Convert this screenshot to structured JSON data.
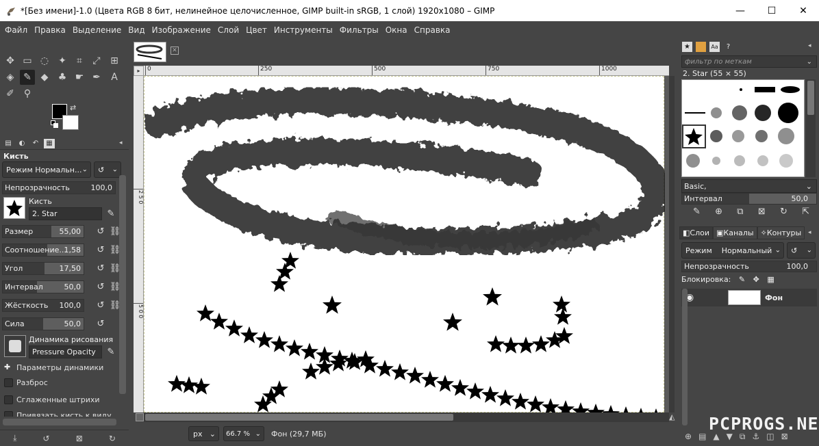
{
  "window": {
    "title": "*[Без имени]-1.0 (Цвета RGB 8 бит, нелинейное целочисленное, GIMP built-in sRGB, 1 слой) 1920x1080 – GIMP",
    "minimize": "—",
    "maximize": "☐",
    "close": "✕"
  },
  "menu": [
    "Файл",
    "Правка",
    "Выделение",
    "Вид",
    "Изображение",
    "Слой",
    "Цвет",
    "Инструменты",
    "Фильтры",
    "Окна",
    "Справка"
  ],
  "tool_options": {
    "title": "Кисть",
    "mode": "Режим Нормальн...",
    "opacity_label": "Непрозрачность",
    "opacity_value": "100,0",
    "brush_label": "Кисть",
    "brush_value": "2. Star",
    "size_label": "Размер",
    "size_value": "55,00",
    "aspect_label": "Соотношение...",
    "aspect_value": "1,58",
    "angle_label": "Угол",
    "angle_value": "17,50",
    "spacing_label": "Интервал",
    "spacing_value": "50,0",
    "hardness_label": "Жёсткость",
    "hardness_value": "100,0",
    "force_label": "Сила",
    "force_value": "50,0",
    "dynamics_label": "Динамика рисования",
    "dynamics_value": "Pressure Opacity",
    "dynamics_params": "Параметры динамики",
    "scatter": "Разброс",
    "smooth": "Сглаженные штрихи",
    "lock_brush": "Привязать кисть к виду"
  },
  "ruler": {
    "h": [
      "0",
      "250",
      "500",
      "750",
      "1000"
    ],
    "v": [
      "2 5 0",
      "5 0 0"
    ]
  },
  "status": {
    "unit": "px",
    "zoom": "66.7 %",
    "info": "Фон (29,7 МБ)"
  },
  "brushes": {
    "filter_placeholder": "фильтр по меткам",
    "current": "2. Star (55 × 55)",
    "preset": "Basic,",
    "spacing_label": "Интервал",
    "spacing_value": "50,0"
  },
  "layers": {
    "tab_layers": "Слои",
    "tab_channels": "Каналы",
    "tab_paths": "Контуры",
    "mode_label": "Режим",
    "mode_value": "Нормальный",
    "opacity_label": "Непрозрачность",
    "opacity_value": "100,0",
    "lock_label": "Блокировка:",
    "layer_name": "Фон"
  },
  "watermark": "PCPROGS.NET"
}
